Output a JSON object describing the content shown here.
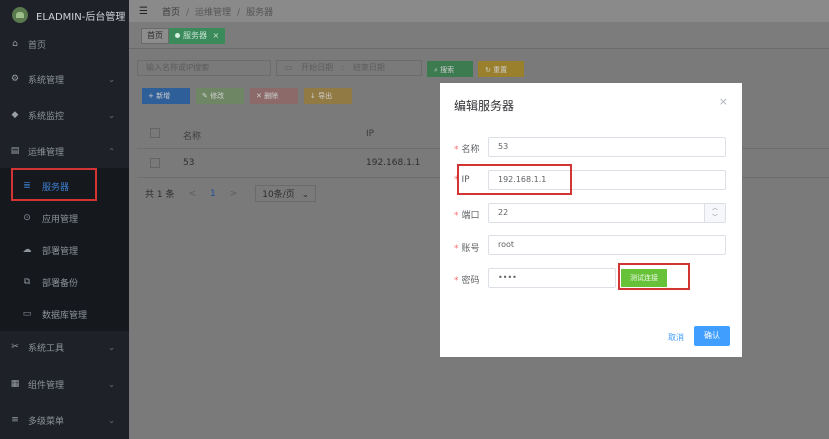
{
  "app": {
    "title": "ELADMIN-后台管理"
  },
  "sidebar": {
    "items": [
      {
        "label": "首页",
        "icon": "home-icon"
      },
      {
        "label": "系统管理",
        "icon": "gear-icon"
      },
      {
        "label": "系统监控",
        "icon": "shield-icon"
      },
      {
        "label": "运维管理",
        "icon": "server-icon"
      },
      {
        "label": "系统工具",
        "icon": "tools-icon"
      },
      {
        "label": "组件管理",
        "icon": "grid-icon"
      },
      {
        "label": "多级菜单",
        "icon": "list-icon"
      }
    ],
    "sub_items": [
      {
        "label": "服务器",
        "icon": "server-icon"
      },
      {
        "label": "应用管理",
        "icon": "app-icon"
      },
      {
        "label": "部署管理",
        "icon": "cloud-icon"
      },
      {
        "label": "部署备份",
        "icon": "backup-icon"
      },
      {
        "label": "数据库管理",
        "icon": "database-icon"
      }
    ]
  },
  "header": {
    "breadcrumb": [
      "首页",
      "运维管理",
      "服务器"
    ],
    "breadcrumb_sep": "/"
  },
  "tags": {
    "home": "首页",
    "current": "服务器",
    "close": "×"
  },
  "filters": {
    "search_placeholder": "输入名称或IP搜索",
    "start_date": "开始日期",
    "range_sep": ":",
    "end_date": "结束日期",
    "search_btn": "搜索",
    "reset_btn": "重置"
  },
  "toolbar": {
    "add": "新增",
    "edit": "修改",
    "delete": "删除",
    "export": "导出"
  },
  "table": {
    "headers": {
      "name": "名称",
      "ip": "IP"
    },
    "rows": [
      {
        "name": "53",
        "ip": "192.168.1.1"
      }
    ]
  },
  "pagination": {
    "total": "共 1 条",
    "prev": "<",
    "page": "1",
    "next": ">",
    "page_size": "10条/页"
  },
  "modal": {
    "title": "编辑服务器",
    "close": "×",
    "required_mark": "*",
    "fields": {
      "name": {
        "label": "名称",
        "value": "53"
      },
      "ip": {
        "label": "IP",
        "value": "192.168.1.1"
      },
      "port": {
        "label": "端口",
        "value": "22"
      },
      "account": {
        "label": "账号",
        "value": "root"
      },
      "password": {
        "label": "密码",
        "value": "••••"
      }
    },
    "test_btn": "测试连接",
    "cancel": "取消",
    "confirm": "确认"
  },
  "colors": {
    "accent": "#409eff",
    "success": "#67c23a",
    "danger": "#f56c6c",
    "highlight": "#d23434"
  }
}
